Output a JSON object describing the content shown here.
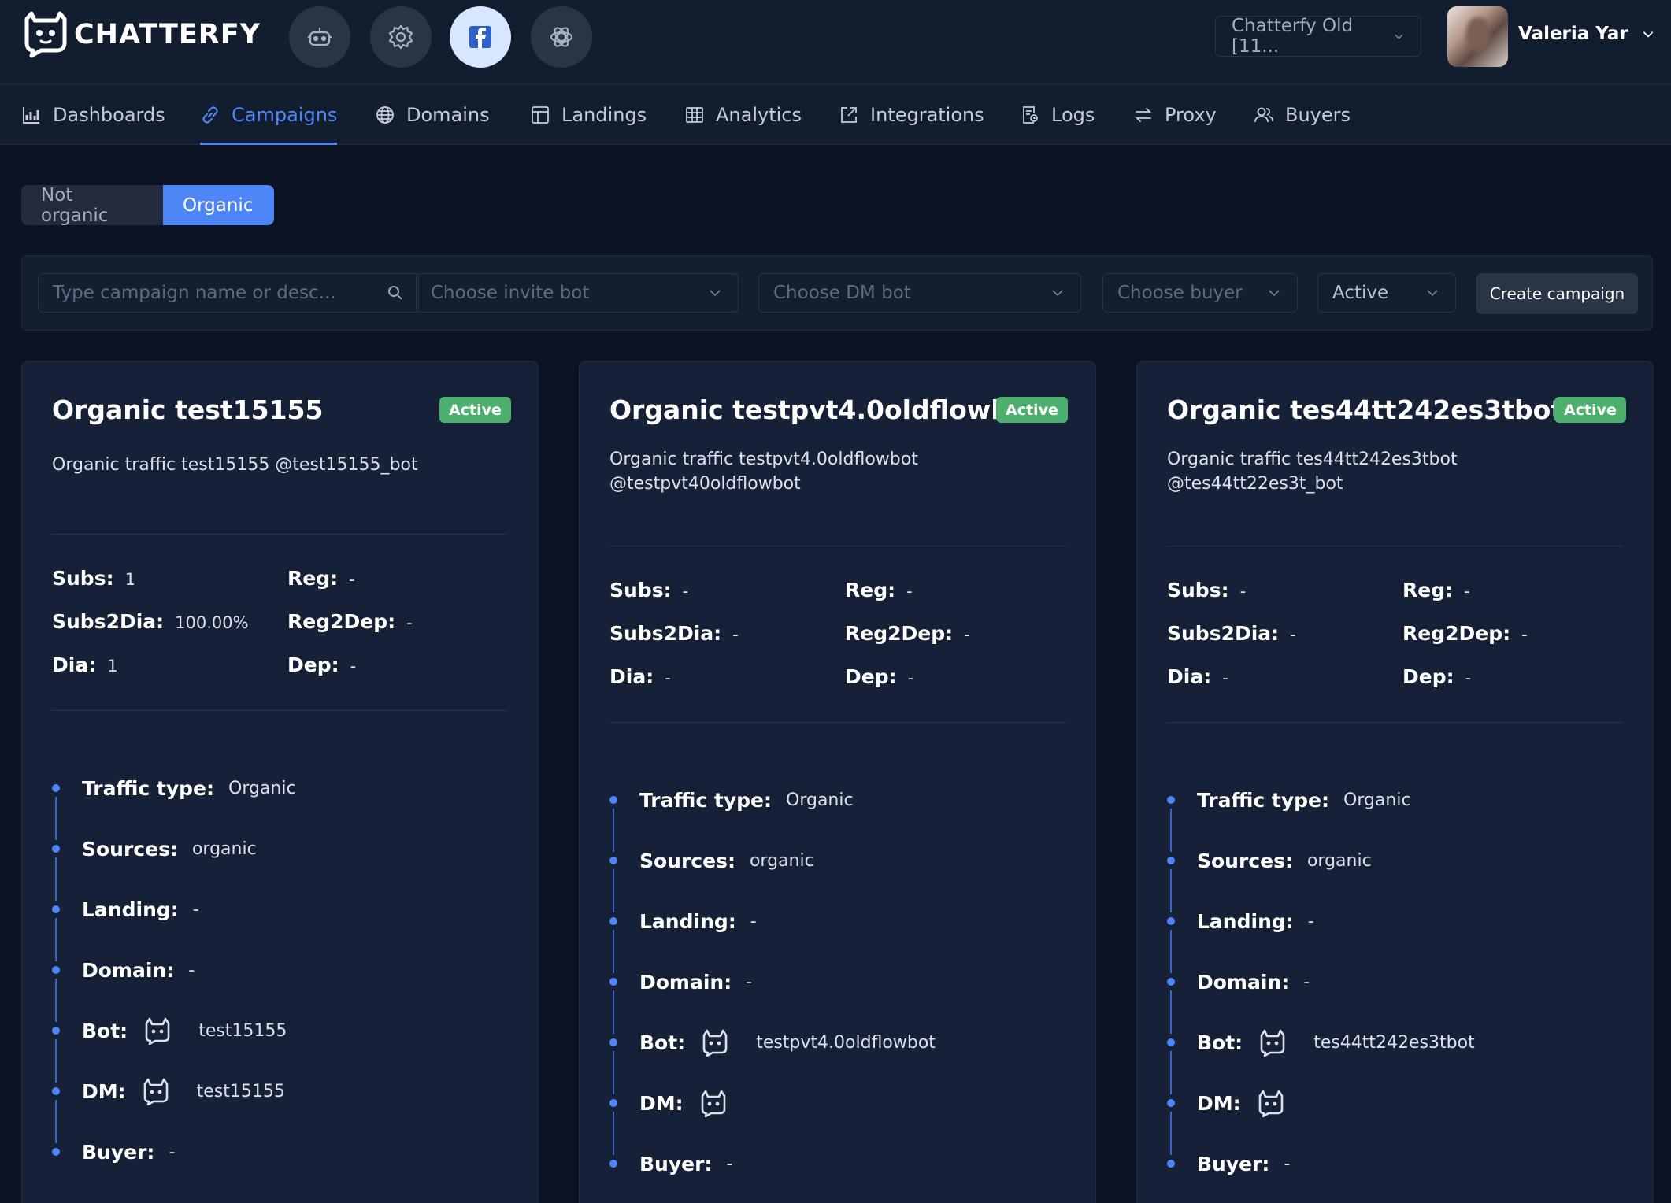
{
  "brand": {
    "name": "CHATTERFY"
  },
  "top_icons": [
    "robot-icon",
    "gear-icon",
    "facebook-icon",
    "openai-icon"
  ],
  "workspace": {
    "label": "Chatterfy Old [11..."
  },
  "user": {
    "name": "Valeria Yar"
  },
  "nav": [
    {
      "label": "Dashboards",
      "icon": "chart-icon"
    },
    {
      "label": "Campaigns",
      "icon": "link-icon",
      "active": true
    },
    {
      "label": "Domains",
      "icon": "globe-icon"
    },
    {
      "label": "Landings",
      "icon": "layout-icon"
    },
    {
      "label": "Analytics",
      "icon": "table-icon"
    },
    {
      "label": "Integrations",
      "icon": "external-link-icon"
    },
    {
      "label": "Logs",
      "icon": "log-icon"
    },
    {
      "label": "Proxy",
      "icon": "arrows-icon"
    },
    {
      "label": "Buyers",
      "icon": "users-icon"
    }
  ],
  "segment": {
    "not_organic": "Not organic",
    "organic": "Organic",
    "selected": "Organic"
  },
  "filters": {
    "search_placeholder": "Type campaign name or desc...",
    "invite_bot": "Choose invite bot",
    "dm_bot": "Choose DM bot",
    "buyer": "Choose buyer",
    "status": "Active",
    "create": "Create campaign"
  },
  "labels": {
    "subs": "Subs:",
    "subs2dia": "Subs2Dia:",
    "dia": "Dia:",
    "reg": "Reg:",
    "reg2dep": "Reg2Dep:",
    "dep": "Dep:",
    "traffic_type": "Traffic type:",
    "sources": "Sources:",
    "landing": "Landing:",
    "domain": "Domain:",
    "bot": "Bot:",
    "dm": "DM:",
    "buyer": "Buyer:"
  },
  "colors": {
    "accent": "#4f86f7",
    "active_badge": "#4caf6e",
    "background": "#0c1424",
    "card": "#162036"
  },
  "cards": [
    {
      "title": "Organic test15155",
      "status": "Active",
      "desc1": "Organic traffic test15155 @test15155_bot",
      "desc2": "",
      "subs": "1",
      "subs2dia": "100.00%",
      "dia": "1",
      "reg": "-",
      "reg2dep": "-",
      "dep": "-",
      "traffic_type": "Organic",
      "sources": "organic",
      "landing": "-",
      "domain": "-",
      "bot": "test15155",
      "dm": "test15155",
      "buyer": "-"
    },
    {
      "title": "Organic testpvt4.0oldflowbot",
      "status": "Active",
      "desc1": "Organic traffic testpvt4.0oldflowbot",
      "desc2": "@testpvt40oldflowbot",
      "subs": "-",
      "subs2dia": "-",
      "dia": "-",
      "reg": "-",
      "reg2dep": "-",
      "dep": "-",
      "traffic_type": "Organic",
      "sources": "organic",
      "landing": "-",
      "domain": "-",
      "bot": "testpvt4.0oldflowbot",
      "dm": "",
      "buyer": "-"
    },
    {
      "title": "Organic tes44tt242es3tbot",
      "status": "Active",
      "desc1": "Organic traffic tes44tt242es3tbot",
      "desc2": "@tes44tt22es3t_bot",
      "subs": "-",
      "subs2dia": "-",
      "dia": "-",
      "reg": "-",
      "reg2dep": "-",
      "dep": "-",
      "traffic_type": "Organic",
      "sources": "organic",
      "landing": "-",
      "domain": "-",
      "bot": "tes44tt242es3tbot",
      "dm": "",
      "buyer": "-"
    }
  ]
}
